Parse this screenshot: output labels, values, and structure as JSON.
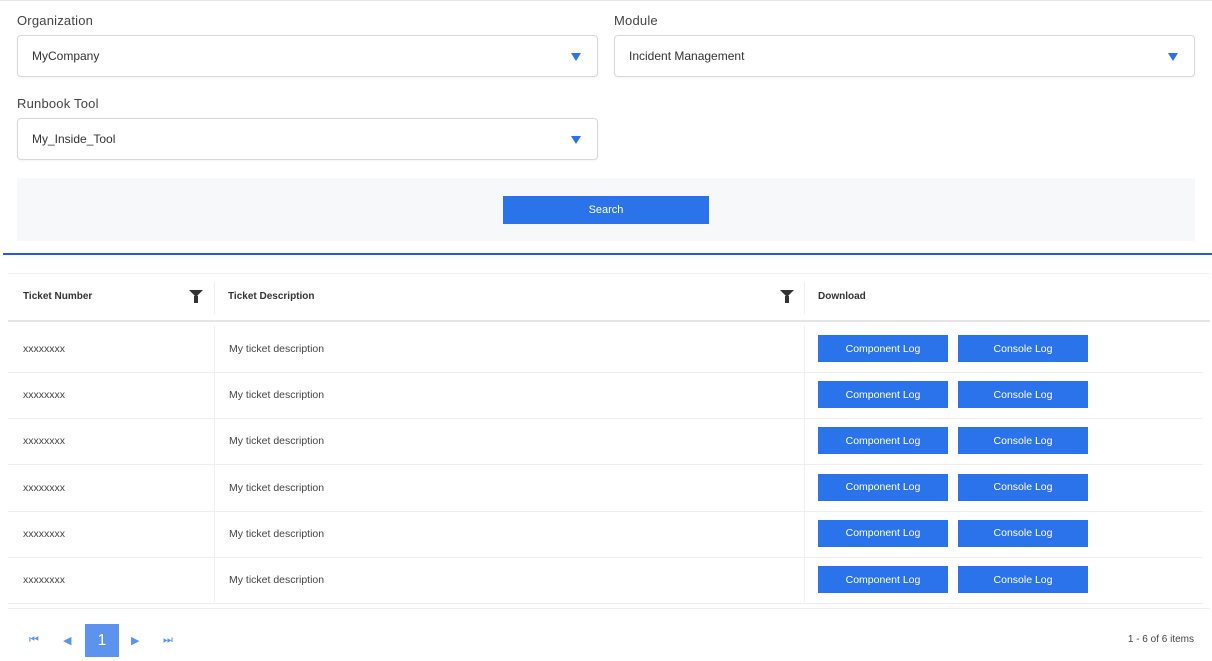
{
  "filters": {
    "organization": {
      "label": "Organization",
      "value": "MyCompany"
    },
    "module": {
      "label": "Module",
      "value": "Incident Management"
    },
    "runbook": {
      "label": "Runbook Tool",
      "value": "My_Inside_Tool"
    },
    "search_label": "Search"
  },
  "table": {
    "headers": [
      "Ticket Number",
      "Ticket Description",
      "Download"
    ],
    "rows": [
      {
        "number": "xxxxxxxx",
        "description": "My ticket description"
      },
      {
        "number": "xxxxxxxx",
        "description": "My ticket description"
      },
      {
        "number": "xxxxxxxx",
        "description": "My ticket description"
      },
      {
        "number": "xxxxxxxx",
        "description": "My ticket description"
      },
      {
        "number": "xxxxxxxx",
        "description": "My ticket description"
      },
      {
        "number": "xxxxxxxx",
        "description": "My ticket description"
      }
    ],
    "component_label": "Component Log",
    "console_label": "Console Log"
  },
  "pager": {
    "page": "1",
    "info": "1 - 6 of 6 items"
  }
}
